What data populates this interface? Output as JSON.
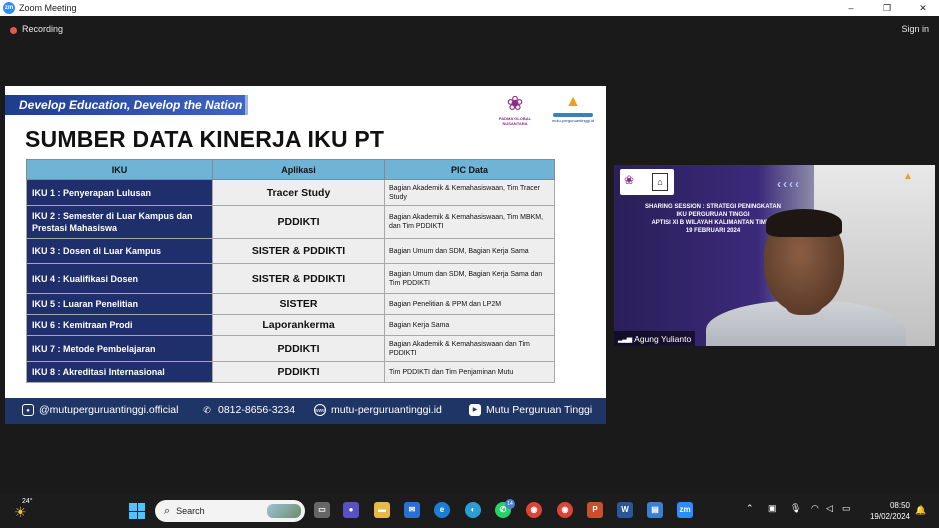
{
  "window": {
    "title": "Zoom Meeting",
    "minimize": "–",
    "maximize": "❐",
    "close": "✕"
  },
  "meeting": {
    "recording": "Recording",
    "sign_in": "Sign in"
  },
  "slide": {
    "banner": "Develop Education, Develop the Nation",
    "title": "SUMBER DATA KINERJA IKU PT",
    "logo_left_caption": "PADMA GLOBAL NUSANTARA",
    "logo_right_caption": "mutu-perguruantinggi.id",
    "headers": [
      "IKU",
      "Aplikasi",
      "PIC Data"
    ],
    "rows": [
      {
        "iku": "IKU 1 : Penyerapan Lulusan",
        "app": "Tracer Study",
        "pic": "Bagian Akademik & Kemahasiswaan, Tim Tracer Study"
      },
      {
        "iku": "IKU 2 : Semester di Luar Kampus dan Prestasi Mahasiswa",
        "app": "PDDIKTI",
        "pic": "Bagian Akademik & Kemahasiswaan, Tim MBKM, dan Tim PDDIKTI"
      },
      {
        "iku": "IKU 3 : Dosen di Luar Kampus",
        "app": "SISTER & PDDIKTI",
        "pic": "Bagian Umum dan SDM, Bagian Kerja Sama"
      },
      {
        "iku": "IKU 4 : Kualifikasi Dosen",
        "app": "SISTER & PDDIKTI",
        "pic": "Bagian Umum dan SDM, Bagian Kerja Sama dan Tim PDDIKTI"
      },
      {
        "iku": "IKU 5 : Luaran Penelitian",
        "app": "SISTER",
        "pic": "Bagian Penelitian & PPM dan LP2M"
      },
      {
        "iku": "IKU 6 : Kemitraan Prodi",
        "app": "Laporankerma",
        "pic": "Bagian Kerja Sama"
      },
      {
        "iku": "IKU 7 : Metode Pembelajaran",
        "app": "PDDIKTI",
        "pic": "Bagian Akademik & Kemahasiswaan dan Tim PDDIKTI"
      },
      {
        "iku": "IKU 8 : Akreditasi Internasional",
        "app": "PDDIKTI",
        "pic": "Tim PDDIKTI dan Tim Penjaminan Mutu"
      }
    ],
    "footer": {
      "instagram": "@mutuperguruantinggi.official",
      "phone": "0812-8656-3234",
      "website": "mutu-perguruantinggi.id",
      "youtube": "Mutu Perguruan Tinggi"
    }
  },
  "video": {
    "participant_name": "Agung  Yulianto",
    "background_text": [
      "SHARING SESSION : STRATEGI PENINGKATAN",
      "IKU PERGURUAN TINGGI",
      "APTISI XI B WILAYAH KALIMANTAN TIMUR",
      "19 FEBRUARI 2024"
    ]
  },
  "taskbar": {
    "temperature": "24°",
    "search_label": "Search",
    "whatsapp_badge": "14",
    "time": "08:50",
    "date": "19/02/2024"
  },
  "colors": {
    "slide_header": "#6fb4d6",
    "iku_cell": "#1f2f6b",
    "footer": "#1e3566",
    "banner": "#2f52b0"
  }
}
